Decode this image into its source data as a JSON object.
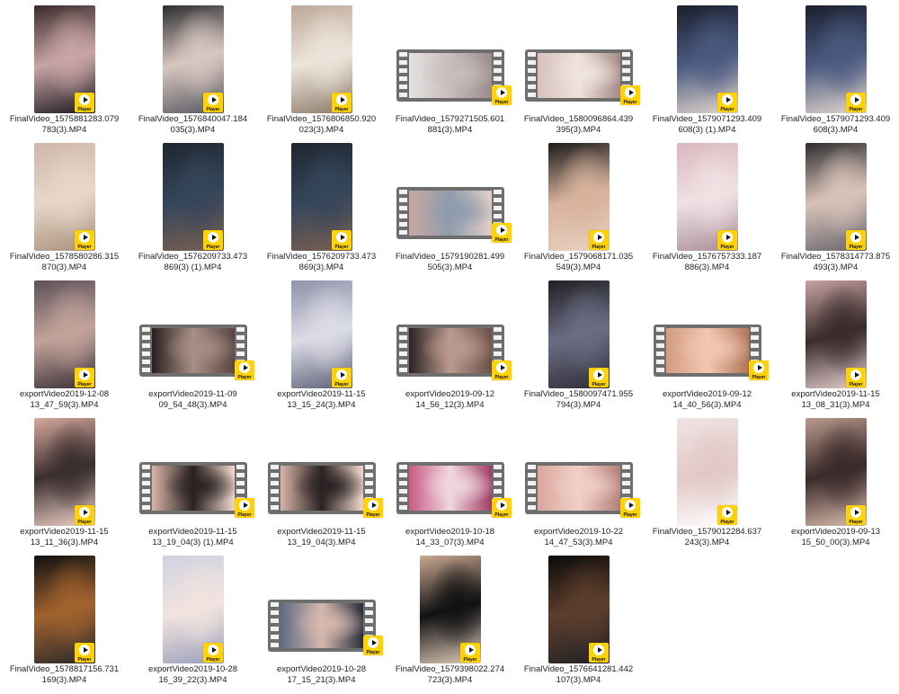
{
  "badge_label": "Player",
  "files": [
    {
      "line1": "FinalVideo_1575881283.079",
      "line2": "783(3).MP4",
      "thumb": "portrait",
      "palette": [
        "#3a2a2a",
        "#c9a5a5",
        "#1e1b22"
      ]
    },
    {
      "line1": "FinalVideo_1576840047.184",
      "line2": "035(3).MP4",
      "thumb": "portrait",
      "palette": [
        "#2c2c30",
        "#d8c7c0",
        "#5a5a62"
      ]
    },
    {
      "line1": "FinalVideo_1576806850.920",
      "line2": "023(3).MP4",
      "thumb": "portrait",
      "palette": [
        "#bda999",
        "#ece4da",
        "#8d7b6c"
      ]
    },
    {
      "line1": "FinalVideo_1579271505.601",
      "line2": "881(3).MP4",
      "thumb": "film",
      "palette": [
        "#e6e2e2",
        "#c9bcbc",
        "#9a8c8c"
      ]
    },
    {
      "line1": "FinalVideo_1580096864.439",
      "line2": "395(3).MP4",
      "thumb": "film",
      "palette": [
        "#d6c1bc",
        "#efe3de",
        "#a58a86"
      ]
    },
    {
      "line1": "FinalVideo_1579071293.409",
      "line2": "608(3) (1).MP4",
      "thumb": "portrait",
      "palette": [
        "#1b1f2c",
        "#4a5a80",
        "#e6d8ce"
      ]
    },
    {
      "line1": "FinalVideo_1579071293.409",
      "line2": "608(3).MP4",
      "thumb": "portrait",
      "palette": [
        "#1b1f2c",
        "#4a5a80",
        "#e6d8ce"
      ]
    },
    {
      "line1": "FinalVideo_1578580286.315",
      "line2": "870(3).MP4",
      "thumb": "portrait",
      "palette": [
        "#cdb7a8",
        "#e8d6c8",
        "#a8907c"
      ]
    },
    {
      "line1": "FinalVideo_1576209733.473",
      "line2": "869(3) (1).MP4",
      "thumb": "portrait",
      "palette": [
        "#1f2630",
        "#35465a",
        "#7b5f52"
      ]
    },
    {
      "line1": "FinalVideo_1576209733.473",
      "line2": "869(3).MP4",
      "thumb": "portrait",
      "palette": [
        "#1f2630",
        "#35465a",
        "#7b5f52"
      ]
    },
    {
      "line1": "FinalVideo_1579190281.499",
      "line2": "505(3).MP4",
      "thumb": "film",
      "palette": [
        "#c9a9a0",
        "#8f9cae",
        "#e4cfc6"
      ]
    },
    {
      "line1": "FinalVideo_1579068171.035",
      "line2": "549(3).MP4",
      "thumb": "portrait",
      "palette": [
        "#1a1a1a",
        "#d7b29b",
        "#e9d2c2"
      ]
    },
    {
      "line1": "FinalVideo_1576757333.187",
      "line2": "886(3).MP4",
      "thumb": "portrait",
      "palette": [
        "#d9b7bd",
        "#f0e1e3",
        "#a78e95"
      ]
    },
    {
      "line1": "FinalVideo_1578314773.875",
      "line2": "493(3).MP4",
      "thumb": "portrait",
      "palette": [
        "#2e2c30",
        "#d8c3b8",
        "#6a6570"
      ]
    },
    {
      "line1": "exportVideo2019-12-08",
      "line2": "13_47_59(3).MP4",
      "thumb": "portrait",
      "palette": [
        "#5c5059",
        "#c2a39a",
        "#3a3038"
      ]
    },
    {
      "line1": "exportVideo2019-11-09",
      "line2": "09_54_48(3).MP4",
      "thumb": "film",
      "palette": [
        "#2a2020",
        "#a88f86",
        "#5a4542"
      ]
    },
    {
      "line1": "exportVideo2019-11-15",
      "line2": "13_15_24(3).MP4",
      "thumb": "portrait",
      "palette": [
        "#8e92a8",
        "#dcdce6",
        "#5e6277"
      ]
    },
    {
      "line1": "exportVideo2019-09-12",
      "line2": "14_56_12(3).MP4",
      "thumb": "film",
      "palette": [
        "#2b2222",
        "#bb9a8e",
        "#6b5049"
      ]
    },
    {
      "line1": "FinalVideo_1580097471.955",
      "line2": "794(3).MP4",
      "thumb": "portrait",
      "palette": [
        "#202024",
        "#6a6c82",
        "#2f2f38"
      ]
    },
    {
      "line1": "exportVideo2019-09-12",
      "line2": "14_40_56(3).MP4",
      "thumb": "film",
      "palette": [
        "#d49c82",
        "#f1c7b0",
        "#b2765c"
      ]
    },
    {
      "line1": "exportVideo2019-11-15",
      "line2": "13_08_31(3).MP4",
      "thumb": "portrait",
      "palette": [
        "#c9a2a2",
        "#3a2c2c",
        "#e6cfcf"
      ]
    },
    {
      "line1": "exportVideo2019-11-15",
      "line2": "13_11_36(3).MP4",
      "thumb": "portrait",
      "palette": [
        "#d6a89c",
        "#3a2e2e",
        "#efd3c8"
      ]
    },
    {
      "line1": "exportVideo2019-11-15",
      "line2": "13_19_04(3) (1).MP4",
      "thumb": "film",
      "palette": [
        "#d9b4a8",
        "#2a2222",
        "#f0d8ce"
      ]
    },
    {
      "line1": "exportVideo2019-11-15",
      "line2": "13_19_04(3).MP4",
      "thumb": "film",
      "palette": [
        "#d9b4a8",
        "#2a2222",
        "#f0d8ce"
      ]
    },
    {
      "line1": "exportVideo2019-10-18",
      "line2": "14_33_07(3).MP4",
      "thumb": "film",
      "palette": [
        "#c85b86",
        "#f0d7dd",
        "#a03c66"
      ]
    },
    {
      "line1": "exportVideo2019-10-22",
      "line2": "14_47_53(3).MP4",
      "thumb": "film",
      "palette": [
        "#d9a79e",
        "#f1cfc6",
        "#b4807a"
      ]
    },
    {
      "line1": "FinalVideo_1579012284.637",
      "line2": "243(3).MP4",
      "thumb": "portrait",
      "palette": [
        "#efe5e4",
        "#e2c9c7",
        "#ffffff"
      ]
    },
    {
      "line1": "exportVideo2019-09-13",
      "line2": "15_50_00(3).MP4",
      "thumb": "portrait",
      "palette": [
        "#b99a8c",
        "#3a2a2a",
        "#dcbfb0"
      ]
    },
    {
      "line1": "FinalVideo_1578817156.731",
      "line2": "169(3).MP4",
      "thumb": "portrait",
      "palette": [
        "#0f0f10",
        "#a0622e",
        "#2a2a2a"
      ]
    },
    {
      "line1": "exportVideo2019-10-28",
      "line2": "16_39_22(3).MP4",
      "thumb": "portrait",
      "palette": [
        "#cfd2e2",
        "#f1e3de",
        "#9aa0bb"
      ]
    },
    {
      "line1": "exportVideo2019-10-28",
      "line2": "17_15_21(3).MP4",
      "thumb": "film",
      "palette": [
        "#5e6a86",
        "#d6b8ae",
        "#2a2f3c"
      ]
    },
    {
      "line1": "FinalVideo_1579398022.274",
      "line2": "723(3).MP4",
      "thumb": "portrait",
      "palette": [
        "#cba98f",
        "#111114",
        "#e3cdb8"
      ]
    },
    {
      "line1": "FinalVideo_1576641281.442",
      "line2": "107(3).MP4",
      "thumb": "portrait",
      "palette": [
        "#0c0c0c",
        "#5c3e2c",
        "#222226"
      ]
    }
  ]
}
